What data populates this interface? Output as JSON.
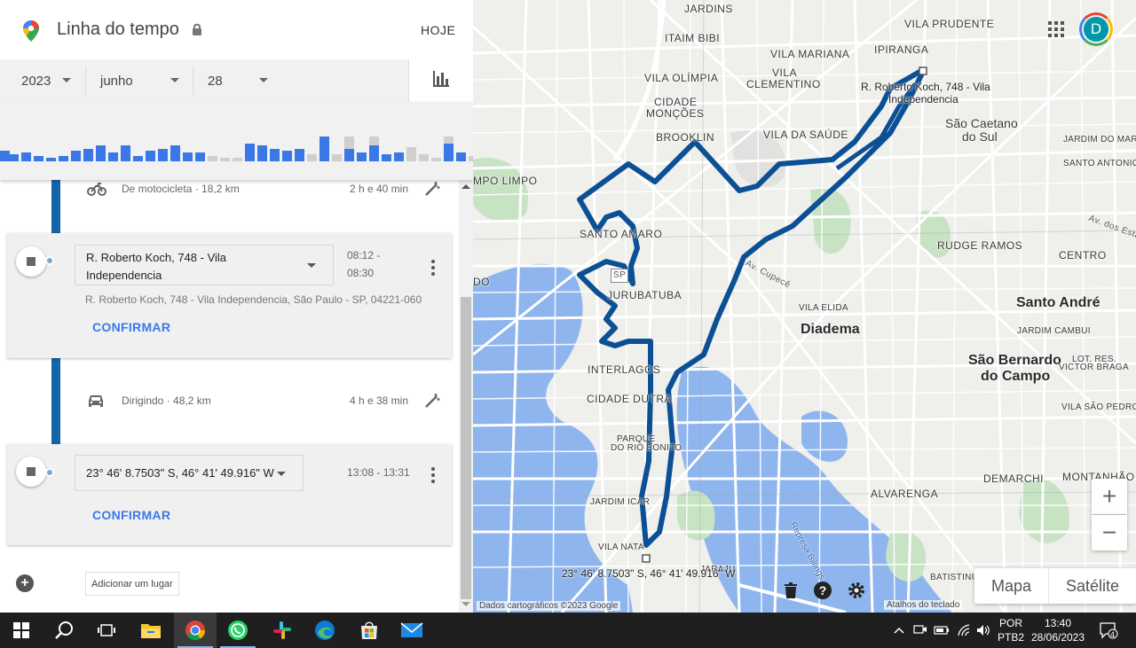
{
  "header": {
    "title": "Linha do tempo",
    "today_label": "HOJE"
  },
  "date_selector": {
    "year": "2023",
    "month": "junho",
    "day": "28"
  },
  "histogram": {
    "colors": {
      "active": "#3b78e7",
      "inactive": "#cfcfcf"
    }
  },
  "timeline": {
    "segments": [
      {
        "icon": "motorcycle-icon",
        "mode": "De motocicleta",
        "distance": " · 18,2 km",
        "duration": "2 h e 40 min"
      },
      {
        "icon": "car-icon",
        "mode": "Dirigindo",
        "distance": " · 48,2 km",
        "duration": "4 h e 38 min"
      }
    ],
    "stops": [
      {
        "name_line1": "R. Roberto Koch, 748 - Vila",
        "name_line2": "Independencia",
        "time_start": "08:12 -",
        "time_end": "08:30",
        "address": "R. Roberto Koch, 748 - Vila Independencia, São Paulo - SP, 04221-060",
        "confirm": "CONFIRMAR"
      },
      {
        "name": "23° 46' 8.7503\" S, 46° 41' 49.916\" W",
        "time": "13:08 - 13:31",
        "confirm": "CONFIRMAR"
      }
    ],
    "add_place": "Adicionar um lugar"
  },
  "map": {
    "labels": {
      "jardins": "JARDINS",
      "vila_prudente": "VILA PRUDENTE",
      "itaim_bibi": "ITAIM BIBI",
      "vila_mariana": "VILA MARIANA",
      "ipiranga": "IPIRANGA",
      "vila_olimpia": "VILA OLÍMPIA",
      "vila_clementino_1": "VILA",
      "vila_clementino_2": "CLEMENTINO",
      "pin_top_1": "R. Roberto Koch, 748 - Vila",
      "pin_top_2": "Independencia",
      "cidade_moncoes_1": "CIDADE",
      "cidade_moncoes_2": "MONÇÕES",
      "sao_caetano_1": "São Caetano",
      "sao_caetano_2": "do Sul",
      "brooklin": "BROOKLIN",
      "vila_da_saude": "VILA DA SAÚDE",
      "jardim_do_mar": "JARDIM DO MAR",
      "santo_antonio": "SANTO ANTONIO",
      "campo_limpo": "MPO LIMPO",
      "av_dos_estados": "Av. dos Esta",
      "santo_amaro": "SANTO AMARO",
      "rudge_ramos": "RUDGE RAMOS",
      "centro": "CENTRO",
      "av_cupece": "Av. Cupecê",
      "sp_shield": "SP",
      "jurubatuba": "JURUBATUBA",
      "do": "DO",
      "vila_elida": "VILA ELIDA",
      "santo_andre": "Santo André",
      "diadema": "Diadema",
      "jardim_cambui": "JARDIM CAMBUI",
      "sao_bernardo_1": "São Bernardo",
      "sao_bernardo_2": "do Campo",
      "lot_res_1": "LOT. RES.",
      "lot_res_2": "VICTOR BRAGA",
      "interlagos": "INTERLAGOS",
      "cidade_dutra": "CIDADE DUTRA",
      "vila_sao_pedro": "VILA SÃO PEDRO",
      "parque_rio_bonito_1": "PARQUE",
      "parque_rio_bonito_2": "DO RIO BONITO",
      "demarchi": "DEMARCHI",
      "montanhao": "MONTANHÃO",
      "jardim_icarai": "JARDIM ICAR",
      "alvarenga": "ALVARENGA",
      "represa": "Represa Billings",
      "vila_natal": "VILA NATA",
      "jaraju": "JARAJU",
      "pin_bottom": "23° 46' 8.7503\" S, 46° 41' 49.916\" W",
      "batistini": "BATISTINI"
    },
    "attribution": "Dados cartográficos ©2023 Google",
    "shortcuts": "Atalhos do teclado",
    "map_type_map": "Mapa",
    "map_type_satellite": "Satélite",
    "zoom_in": "+",
    "zoom_out": "−",
    "avatar_letter": "D",
    "route_color": "#0b4f94"
  },
  "taskbar": {
    "language_1": "POR",
    "language_2": "PTB2",
    "time": "13:40",
    "date": "28/06/2023",
    "notifications": "4"
  }
}
